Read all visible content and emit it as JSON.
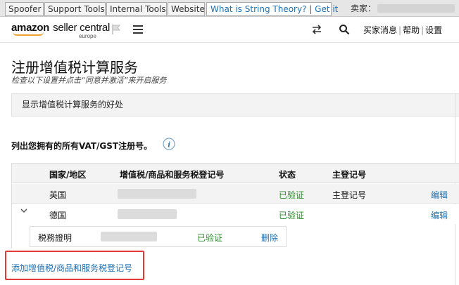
{
  "devbar": {
    "tabs": [
      "Spoofer",
      "Support Tools",
      "Internal Tools",
      "Website"
    ],
    "link_text": "What is String Theory?",
    "link_sep": "|",
    "link_get": "Get it",
    "seller_label": "卖家："
  },
  "header": {
    "logo_brand": "amazon",
    "logo_product": "seller central",
    "logo_region": "europe",
    "links": [
      "买家消息",
      "帮助",
      "设置"
    ],
    "link_sep": "|"
  },
  "page": {
    "title": "注册增值税计算服务",
    "subtitle": "检查以下设置并点击“同意并激活”来开启服务",
    "benefit_label": "显示增值税计算服务的好处",
    "list_label": "列出您拥有的所有VAT/GST注册号。"
  },
  "table": {
    "headers": [
      "国家/地区",
      "增值税/商品和服务税登记号",
      "状态",
      "主登记号"
    ],
    "rows": [
      {
        "country": "英国",
        "status": "已验证",
        "primary": "主登记号",
        "action": "编辑"
      },
      {
        "country": "德国",
        "status": "已验证",
        "primary": "",
        "action": "编辑"
      }
    ],
    "sub_row": {
      "label": "税務證明",
      "status": "已验证",
      "action": "删除"
    }
  },
  "add_link": "添加增值税/商品和服务税登记号",
  "colors": {
    "link": "#1f6fb2",
    "verified": "#2d8a2d",
    "highlight_border": "#e53935",
    "logo_smile": "#f0a030"
  }
}
